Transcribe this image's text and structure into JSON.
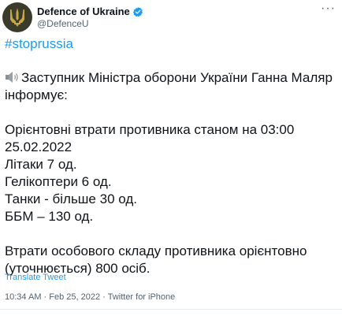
{
  "account": {
    "display_name": "Defence of Ukraine",
    "handle": "@DefenceU"
  },
  "tweet": {
    "hashtag": "#stoprussia",
    "line1": "Заступник Міністра оборони України Ганна Маляр",
    "line2": "інформує:",
    "line3": "Орієнтовні втрати противника станом на 03:00",
    "line4": "25.02.2022",
    "line5": "Літаки 7 од.",
    "line6": "Гелікоптери 6 од.",
    "line7": "Танки - більше 30 од.",
    "line8": "ББМ – 130 од.",
    "line9": "Втрати особового складу противника орієнтовно",
    "line10": "(уточнюється) 800 осіб."
  },
  "translate_label": "Translate Tweet",
  "meta": {
    "time": "10:34 AM",
    "date": "Feb 25, 2022",
    "source": "Twitter for iPhone",
    "separator": " · "
  },
  "icons": {
    "avatar": "ukraine-defence-emblem",
    "verified": "verified-badge-icon",
    "speaker": "speaker-icon",
    "more": "more-options-icon"
  },
  "colors": {
    "link": "#1d9bf0",
    "secondary": "#536471",
    "avatar_bg": "#3b3b2c",
    "emblem": "#c9a646"
  }
}
